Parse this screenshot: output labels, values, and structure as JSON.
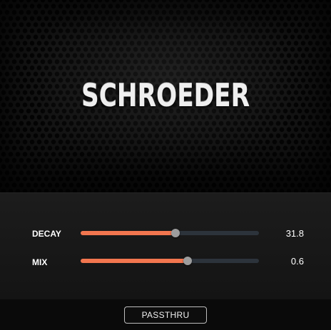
{
  "header": {
    "title": "SCHROEDER"
  },
  "params": [
    {
      "label": "DECAY",
      "value": "31.8",
      "level": 0.53
    },
    {
      "label": "MIX",
      "value": "0.6",
      "level": 0.6
    }
  ],
  "footer": {
    "passthru_label": "PASSTHRU"
  },
  "colors": {
    "accent": "#f2764f",
    "track": "#2c333b",
    "thumb": "#9d9d9d"
  }
}
